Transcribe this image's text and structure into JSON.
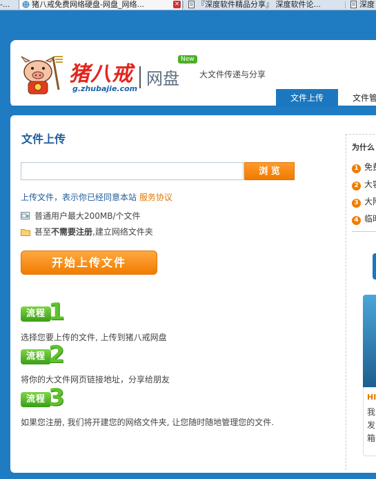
{
  "browser": {
    "tabs": [
      {
        "label": "-..."
      },
      {
        "label": "猪八戒免费网络硬盘-网盘_网络..."
      },
      {
        "label": "『深度软件精品分享』 深度软件论..."
      },
      {
        "label": "深度"
      }
    ],
    "close_glyph": "×"
  },
  "header": {
    "brand": "猪八戒",
    "url": "g.zhubajie.com",
    "product": "网盘",
    "new_badge": "New",
    "tagline": "大文件传递与分享",
    "nav": {
      "active": "文件上传",
      "other": "文件管"
    }
  },
  "upload": {
    "title": "文件上传",
    "file_value": "",
    "browse_label": "浏 览",
    "agree_text": "上传文件，表示你已经同意本站",
    "agree_link": "服务协议",
    "note1": "普通用户最大200MB/个文件",
    "note2_prefix": "甚至",
    "note2_bold": "不需要注册",
    "note2_suffix": ",建立网络文件夹",
    "start_label": "开始上传文件"
  },
  "steps": [
    {
      "badge": "流程",
      "num": "1",
      "text": "选择您要上传的文件, 上传到猪八戒网盘"
    },
    {
      "badge": "流程",
      "num": "2",
      "text": "将你的大文件网页链接地址，分享给朋友"
    },
    {
      "badge": "流程",
      "num": "3",
      "text": "如果您注册, 我们将开建您的网络文件夹, 让您随时随地管理您的文件."
    }
  ],
  "sidebar": {
    "title": "为什么",
    "items": [
      {
        "n": "1",
        "label": "免费"
      },
      {
        "n": "2",
        "label": "大容"
      },
      {
        "n": "3",
        "label": "大附"
      },
      {
        "n": "4",
        "label": "临时"
      }
    ],
    "promo_heading": "HI",
    "promo_lines": [
      "我,",
      "发,",
      "箱"
    ]
  },
  "colors": {
    "brand_blue": "#1b78c0",
    "accent_orange": "#f07c00",
    "brand_red": "#e2261c",
    "step_green": "#5fc22c"
  }
}
